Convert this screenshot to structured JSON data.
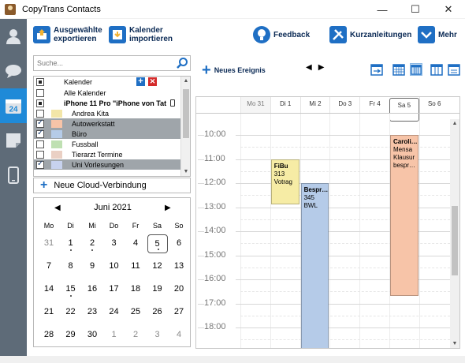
{
  "window": {
    "title": "CopyTrans Contacts",
    "minimize": "—",
    "maximize": "☐",
    "close": "✕"
  },
  "rail": [
    {
      "name": "contacts-icon"
    },
    {
      "name": "messages-icon"
    },
    {
      "name": "calendar-icon",
      "label": "24",
      "active": true
    },
    {
      "name": "notes-icon"
    },
    {
      "name": "phone-icon"
    }
  ],
  "toolbar": {
    "export_label_1": "Ausgewählte",
    "export_label_2": "exportieren",
    "import_label_1": "Kalender",
    "import_label_2": "importieren",
    "feedback_label": "Feedback",
    "guides_label": "Kurzanleitungen",
    "more_label": "Mehr"
  },
  "search": {
    "placeholder": "Suche..."
  },
  "calendar_list": {
    "header": "Kalender",
    "rows": [
      {
        "label": "Alle Kalender",
        "state": "none",
        "color": "",
        "highlight": false,
        "type": "all"
      },
      {
        "label": "iPhone 11 Pro \"iPhone von Tat",
        "state": "indeterminate",
        "color": "",
        "highlight": false,
        "type": "phone"
      },
      {
        "label": "Andrea Kita",
        "state": "none",
        "color": "#f3e6a8",
        "highlight": false,
        "type": "cal"
      },
      {
        "label": "Autowerkstatt",
        "state": "checked",
        "color": "#f7c4a8",
        "highlight": true,
        "type": "cal"
      },
      {
        "label": "Büro",
        "state": "checked",
        "color": "#b5cbe8",
        "highlight": true,
        "type": "cal"
      },
      {
        "label": "Fussball",
        "state": "none",
        "color": "#bfe0b2",
        "highlight": false,
        "type": "cal"
      },
      {
        "label": "Tierarzt Termine",
        "state": "none",
        "color": "#ead0c4",
        "highlight": false,
        "type": "cal"
      },
      {
        "label": "Uni Vorlesungen",
        "state": "checked",
        "color": "#c7d2ee",
        "highlight": true,
        "type": "cal"
      }
    ]
  },
  "cloud_button": "Neue Cloud-Verbindung",
  "mini_calendar": {
    "month": "Juni 2021",
    "weekdays": [
      "Mo",
      "Di",
      "Mi",
      "Do",
      "Fr",
      "Sa",
      "So"
    ],
    "weeks": [
      [
        {
          "d": "31",
          "o": true
        },
        {
          "d": "1",
          "dot": true
        },
        {
          "d": "2",
          "dot": true
        },
        {
          "d": "3"
        },
        {
          "d": "4"
        },
        {
          "d": "5",
          "sel": true,
          "dot": true
        },
        {
          "d": "6"
        }
      ],
      [
        {
          "d": "7"
        },
        {
          "d": "8"
        },
        {
          "d": "9"
        },
        {
          "d": "10"
        },
        {
          "d": "11"
        },
        {
          "d": "12"
        },
        {
          "d": "13"
        }
      ],
      [
        {
          "d": "14"
        },
        {
          "d": "15",
          "dot": true
        },
        {
          "d": "16"
        },
        {
          "d": "17"
        },
        {
          "d": "18"
        },
        {
          "d": "19"
        },
        {
          "d": "20"
        }
      ],
      [
        {
          "d": "21"
        },
        {
          "d": "22"
        },
        {
          "d": "23"
        },
        {
          "d": "24"
        },
        {
          "d": "25"
        },
        {
          "d": "26"
        },
        {
          "d": "27"
        }
      ],
      [
        {
          "d": "28"
        },
        {
          "d": "29"
        },
        {
          "d": "30"
        },
        {
          "d": "1",
          "o": true
        },
        {
          "d": "2",
          "o": true
        },
        {
          "d": "3",
          "o": true
        },
        {
          "d": "4",
          "o": true
        }
      ]
    ]
  },
  "main": {
    "new_event": "Neues Ereignis",
    "nav_prev": "◀",
    "nav_next": "▶",
    "days": [
      "Mo 31",
      "Di 1",
      "Mi 2",
      "Do 3",
      "Fr 4",
      "Sa 5",
      "So 6"
    ],
    "hours": [
      "10:00",
      "11:00",
      "12:00",
      "13:00",
      "14:00",
      "15:00",
      "16:00",
      "17:00",
      "18:00"
    ],
    "events": [
      {
        "title": "FiBu",
        "lines": [
          "313",
          "Votrag"
        ],
        "day": 1,
        "start": 11.0,
        "end": 12.9,
        "color": "#f6eca5"
      },
      {
        "title": "Bespr…",
        "lines": [
          "345",
          "BWL"
        ],
        "day": 2,
        "start": 12.0,
        "end": 18.9,
        "color": "#b5cbe8"
      },
      {
        "title": "Caroli…",
        "lines": [
          "Mensa",
          "Klausur",
          "bespr…"
        ],
        "day": 5,
        "start": 10.0,
        "end": 16.7,
        "color": "#f7c4a8"
      }
    ]
  }
}
